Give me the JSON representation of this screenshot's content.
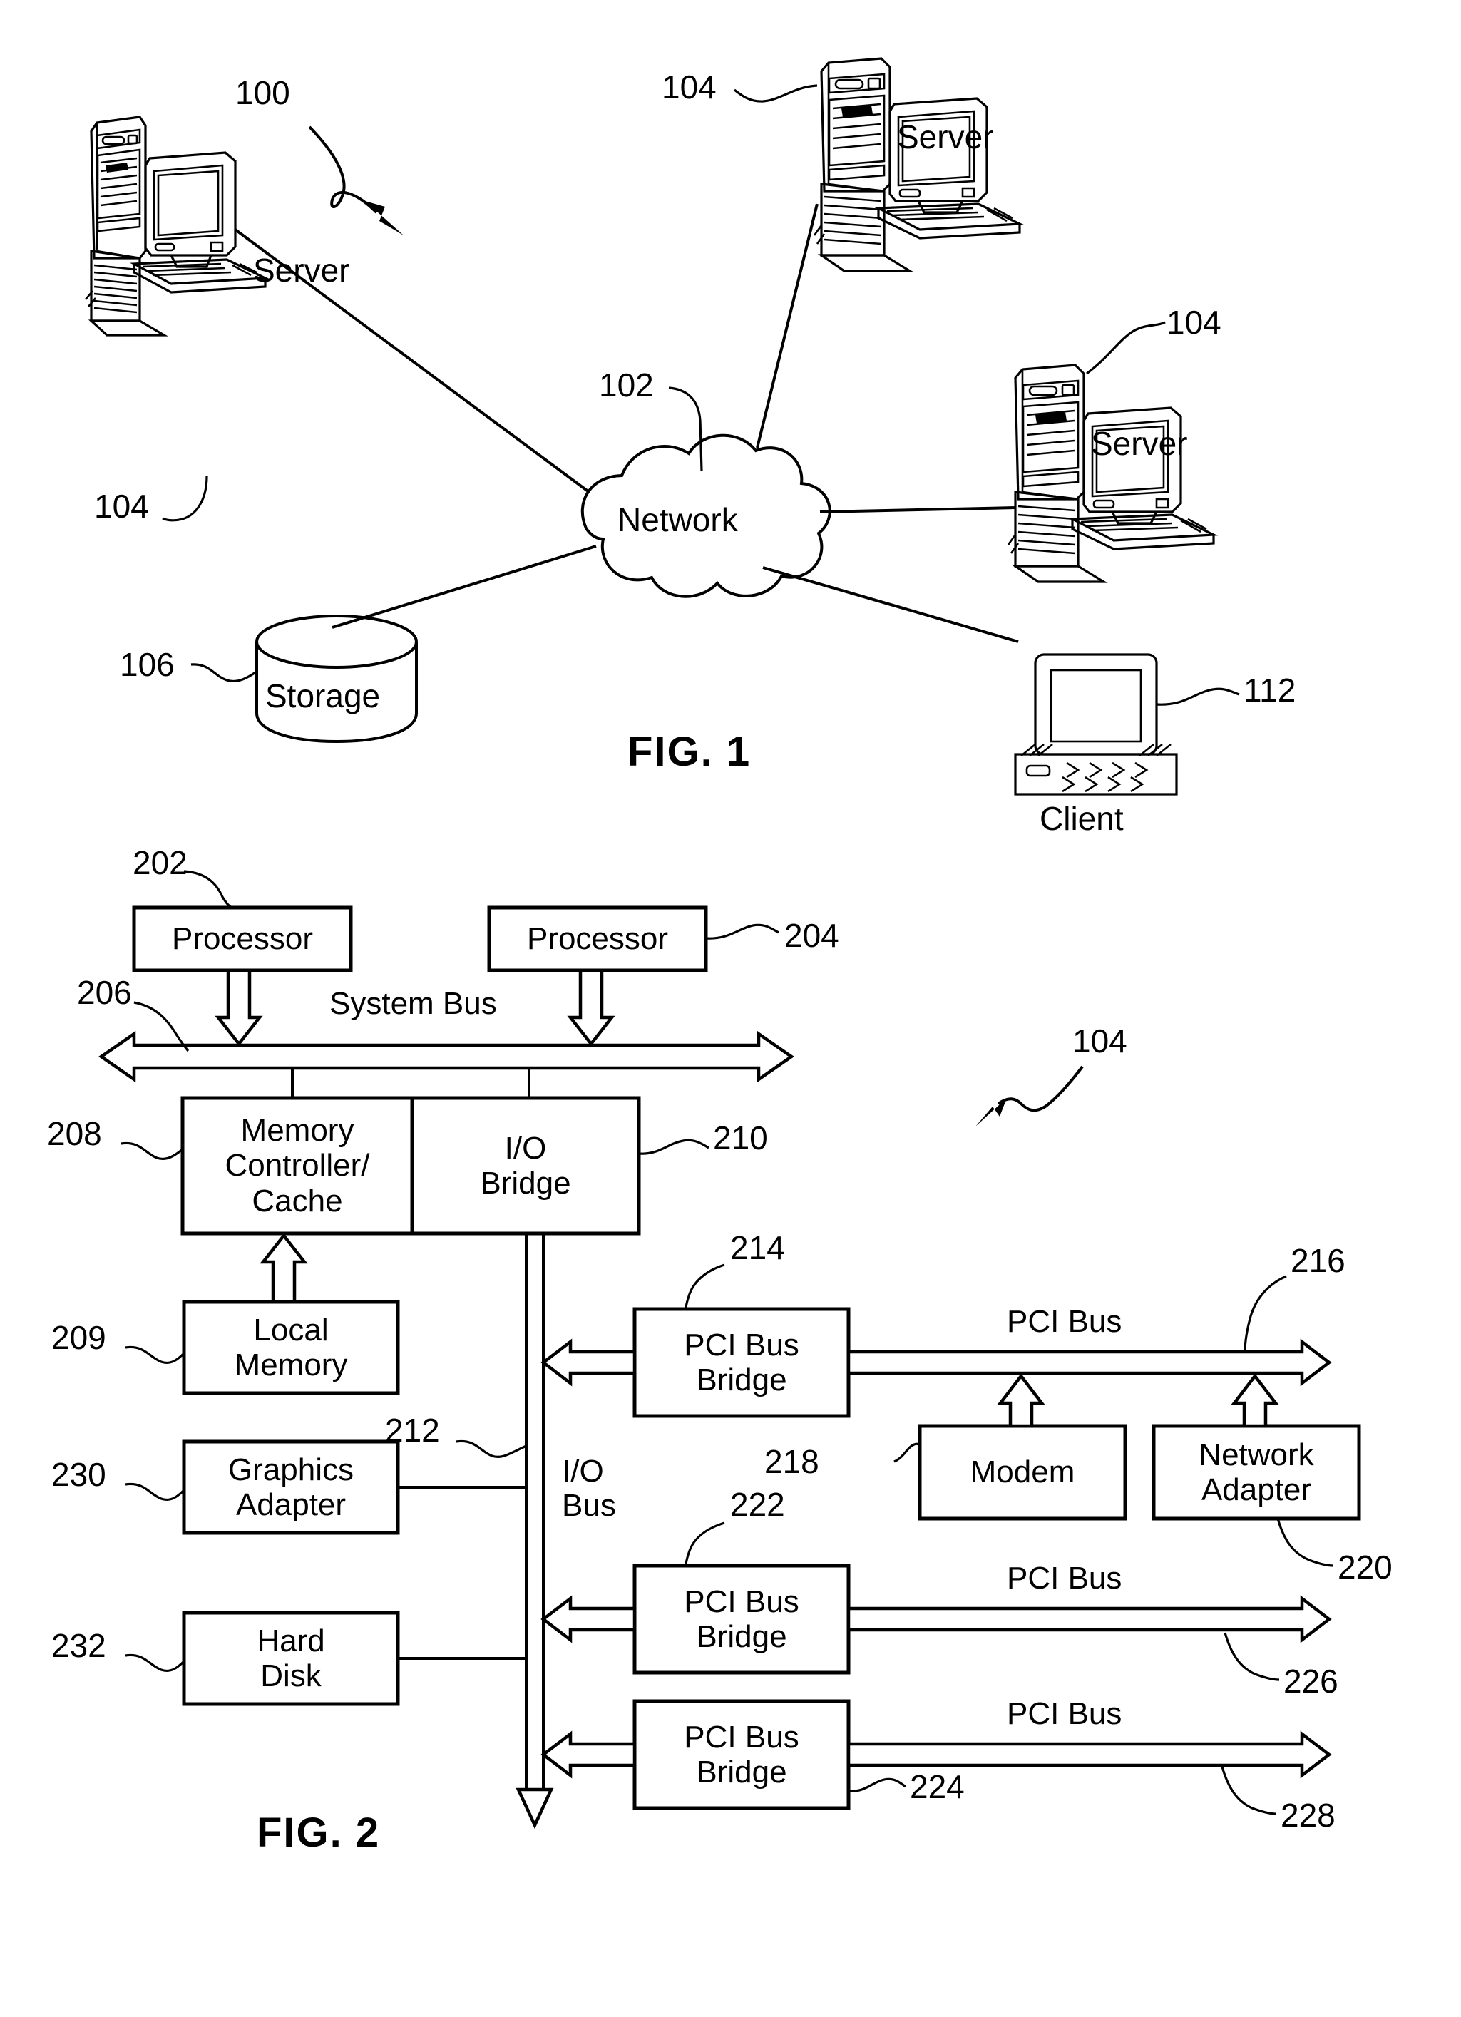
{
  "figures": [
    {
      "id": "fig1",
      "title": "FIG. 1",
      "overall_ref": "100",
      "nodes": {
        "network": {
          "label": "Network",
          "ref": "102"
        },
        "storage": {
          "label": "Storage",
          "ref": "106"
        },
        "client": {
          "label": "Client",
          "ref": "112"
        },
        "server_left": {
          "label": "Server",
          "ref": "104"
        },
        "server_top_right": {
          "label": "Server",
          "ref": "104"
        },
        "server_bottom_right": {
          "label": "Server",
          "ref": "104"
        }
      }
    },
    {
      "id": "fig2",
      "title": "FIG. 2",
      "overall_ref": "104",
      "blocks": [
        {
          "key": "processor_1",
          "label": "Processor",
          "ref": "202"
        },
        {
          "key": "processor_2",
          "label": "Processor",
          "ref": "204"
        },
        {
          "key": "memory_controller_cache",
          "label": "Memory\nController/\nCache",
          "ref": "208"
        },
        {
          "key": "io_bridge",
          "label": "I/O\nBridge",
          "ref": "210"
        },
        {
          "key": "local_memory",
          "label": "Local\nMemory",
          "ref": "209"
        },
        {
          "key": "graphics_adapter",
          "label": "Graphics\nAdapter",
          "ref": "230"
        },
        {
          "key": "hard_disk",
          "label": "Hard\nDisk",
          "ref": "232"
        },
        {
          "key": "pci_bus_bridge_1",
          "label": "PCI Bus\nBridge",
          "ref": "214"
        },
        {
          "key": "pci_bus_bridge_2",
          "label": "PCI Bus\nBridge",
          "ref": "222"
        },
        {
          "key": "pci_bus_bridge_3",
          "label": "PCI Bus\nBridge",
          "ref": "224"
        },
        {
          "key": "modem",
          "label": "Modem",
          "ref": "218"
        },
        {
          "key": "network_adapter",
          "label": "Network\nAdapter",
          "ref": "220"
        }
      ],
      "buses": [
        {
          "key": "system_bus",
          "label": "System Bus",
          "ref": "206"
        },
        {
          "key": "io_bus",
          "label": "I/O\nBus",
          "ref": "212"
        },
        {
          "key": "pci_bus_1",
          "label": "PCI Bus",
          "ref": "216"
        },
        {
          "key": "pci_bus_2",
          "label": "PCI Bus",
          "ref": "226"
        },
        {
          "key": "pci_bus_3",
          "label": "PCI Bus",
          "ref": "228"
        }
      ]
    }
  ],
  "colors": {
    "ink": "#000000",
    "paper": "#ffffff"
  }
}
